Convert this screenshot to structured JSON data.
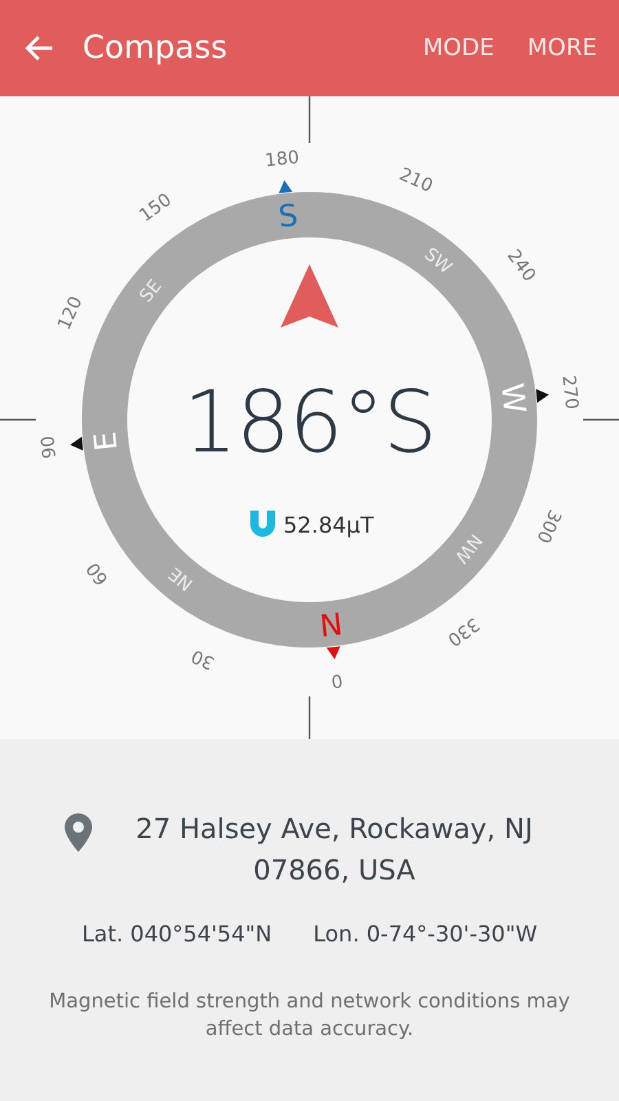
{
  "header": {
    "title": "Compass",
    "actions": [
      "MODE",
      "MORE"
    ]
  },
  "compass": {
    "heading": "186°S",
    "field_strength": "52.84μT",
    "degree_labels": [
      "0",
      "30",
      "60",
      "90",
      "120",
      "150",
      "180",
      "210",
      "240",
      "270",
      "300",
      "330"
    ],
    "directions": [
      {
        "label": "N",
        "kind": "major",
        "color": "#e01010"
      },
      {
        "label": "NE",
        "kind": "minor",
        "color": "#ececec"
      },
      {
        "label": "E",
        "kind": "axis",
        "color": "#ffffff"
      },
      {
        "label": "SE",
        "kind": "minor",
        "color": "#ececec"
      },
      {
        "label": "S",
        "kind": "major",
        "color": "#1a6fb5"
      },
      {
        "label": "SW",
        "kind": "minor",
        "color": "#ececec"
      },
      {
        "label": "W",
        "kind": "axis",
        "color": "#ffffff"
      },
      {
        "label": "NW",
        "kind": "minor",
        "color": "#ececec"
      }
    ]
  },
  "location": {
    "address": "27 Halsey Ave, Rockaway, NJ 07866, USA",
    "latitude": "Lat. 040°54'54\"N",
    "longitude": "Lon. 0-74°-30'-30\"W",
    "note": "Magnetic field strength and network conditions may affect data accuracy."
  }
}
